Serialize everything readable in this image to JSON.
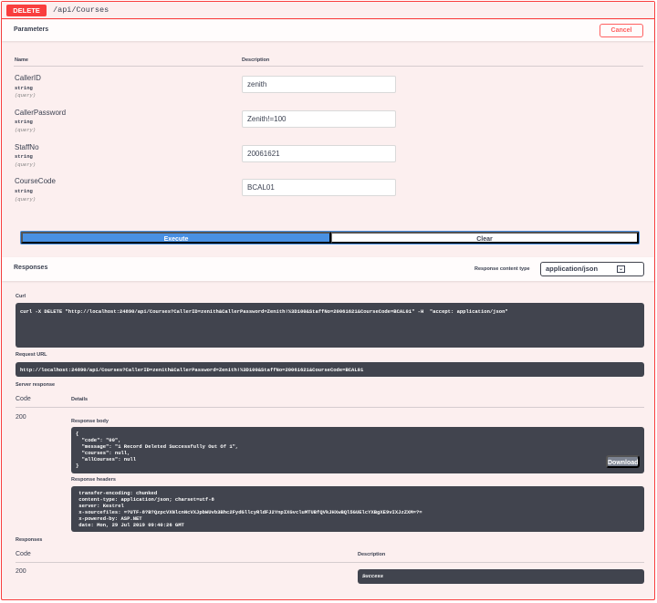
{
  "operation": {
    "method": "DELETE",
    "path": "/api/Courses"
  },
  "parameters": {
    "title": "Parameters",
    "cancel_label": "Cancel",
    "col_name": "Name",
    "col_description": "Description",
    "items": [
      {
        "name": "CallerID",
        "type": "string",
        "in": "(query)",
        "value": "zenith"
      },
      {
        "name": "CallerPassword",
        "type": "string",
        "in": "(query)",
        "value": "Zenith!=100"
      },
      {
        "name": "StaffNo",
        "type": "string",
        "in": "(query)",
        "value": "20061621"
      },
      {
        "name": "CourseCode",
        "type": "string",
        "in": "(query)",
        "value": "BCAL01"
      }
    ],
    "execute_label": "Execute",
    "clear_label": "Clear"
  },
  "responses_section": {
    "title": "Responses",
    "content_type_label": "Response content type",
    "content_type_value": "application/json"
  },
  "curl": {
    "label": "Curl",
    "command": "curl -X DELETE \"http://localhost:24890/api/Courses?CallerID=zenith&CallerPassword=Zenith!%3D100&StaffNo=20061621&CourseCode=BCAL01\" -H  \"accept: application/json\""
  },
  "request_url": {
    "label": "Request URL",
    "value": "http://localhost:24890/api/Courses?CallerID=zenith&CallerPassword=Zenith!%3D100&StaffNo=20061621&CourseCode=BCAL01"
  },
  "server_response": {
    "label": "Server response",
    "col_code": "Code",
    "col_details": "Details",
    "code": "200",
    "body_label": "Response body",
    "body_lines": [
      "{",
      "  \"code\": \"00\",",
      "  \"message\": \"1 Record Deleted Successfully Out Of 1\",",
      "  \"courses\": null,",
      "  \"allCourses\": null",
      "}"
    ],
    "download_label": "Download",
    "headers_label": "Response headers",
    "header_lines": [
      " transfer-encoding: chunked",
      " content-type: application/json; charset=utf-8",
      " server: Kestrel",
      " x-sourcefiles: =?UTF-8?B?QzpcVXNlcnNcVXJpbWUvb3Bhc2FydGllcyRldFJ2YnpIXGvcluMTUBfQVkJHXwBQl5GUElcYXBgXE9vIXJzZXM=?=",
      " x-powered-by: ASP.NET",
      " date: Mon, 29 Jul 2019 09:40:26 GMT"
    ]
  },
  "responses_doc": {
    "label": "Responses",
    "col_code": "Code",
    "col_description": "Description",
    "code": "200",
    "description": "Success"
  }
}
